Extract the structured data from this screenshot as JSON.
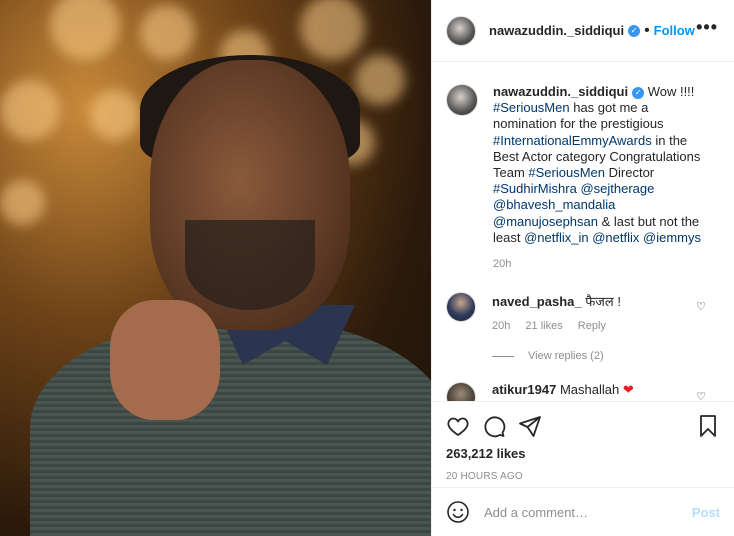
{
  "post": {
    "username": "nawazuddin._siddiqui",
    "follow_label": "Follow",
    "dot": "•",
    "more_label": "•••"
  },
  "caption": {
    "username": "nawazuddin._siddiqui",
    "parts": [
      {
        "text": "Wow !!!! ",
        "tag": false
      },
      {
        "text": "#SeriousMen",
        "tag": true
      },
      {
        "text": " has got me a nomination for the prestigious ",
        "tag": false
      },
      {
        "text": "#InternationalEmmyAwards",
        "tag": true
      },
      {
        "text": " in the Best Actor category Congratulations Team ",
        "tag": false
      },
      {
        "text": "#SeriousMen",
        "tag": true
      },
      {
        "text": " Director ",
        "tag": false
      },
      {
        "text": "#SudhirMishra",
        "tag": true
      },
      {
        "text": " ",
        "tag": false
      },
      {
        "text": "@sejtherage",
        "tag": true
      },
      {
        "text": " ",
        "tag": false
      },
      {
        "text": "@bhavesh_mandalia",
        "tag": true
      },
      {
        "text": " ",
        "tag": false
      },
      {
        "text": "@manujosephsan",
        "tag": true
      },
      {
        "text": " & last but not the least ",
        "tag": false
      },
      {
        "text": "@netflix_in",
        "tag": true
      },
      {
        "text": " ",
        "tag": false
      },
      {
        "text": "@netflix",
        "tag": true
      },
      {
        "text": " ",
        "tag": false
      },
      {
        "text": "@iemmys",
        "tag": true
      }
    ],
    "time": "20h"
  },
  "comments": [
    {
      "username": "naved_pasha_",
      "text": "फैजल !",
      "time": "20h",
      "likes": "21 likes",
      "reply_label": "Reply",
      "view_replies": "View replies (2)"
    },
    {
      "username": "atikur1947",
      "text": "Mashallah",
      "emoji": "❤"
    }
  ],
  "stats": {
    "likes": "263,212 likes",
    "ago": "20 HOURS AGO"
  },
  "add_comment": {
    "placeholder": "Add a comment…",
    "post_label": "Post"
  },
  "icons": {
    "verified": "✓",
    "heart_small": "♡"
  },
  "colors": {
    "link": "#00376b",
    "follow": "#0095f6",
    "post_disabled": "#b2dffc",
    "red_heart": "#ed1c24"
  }
}
